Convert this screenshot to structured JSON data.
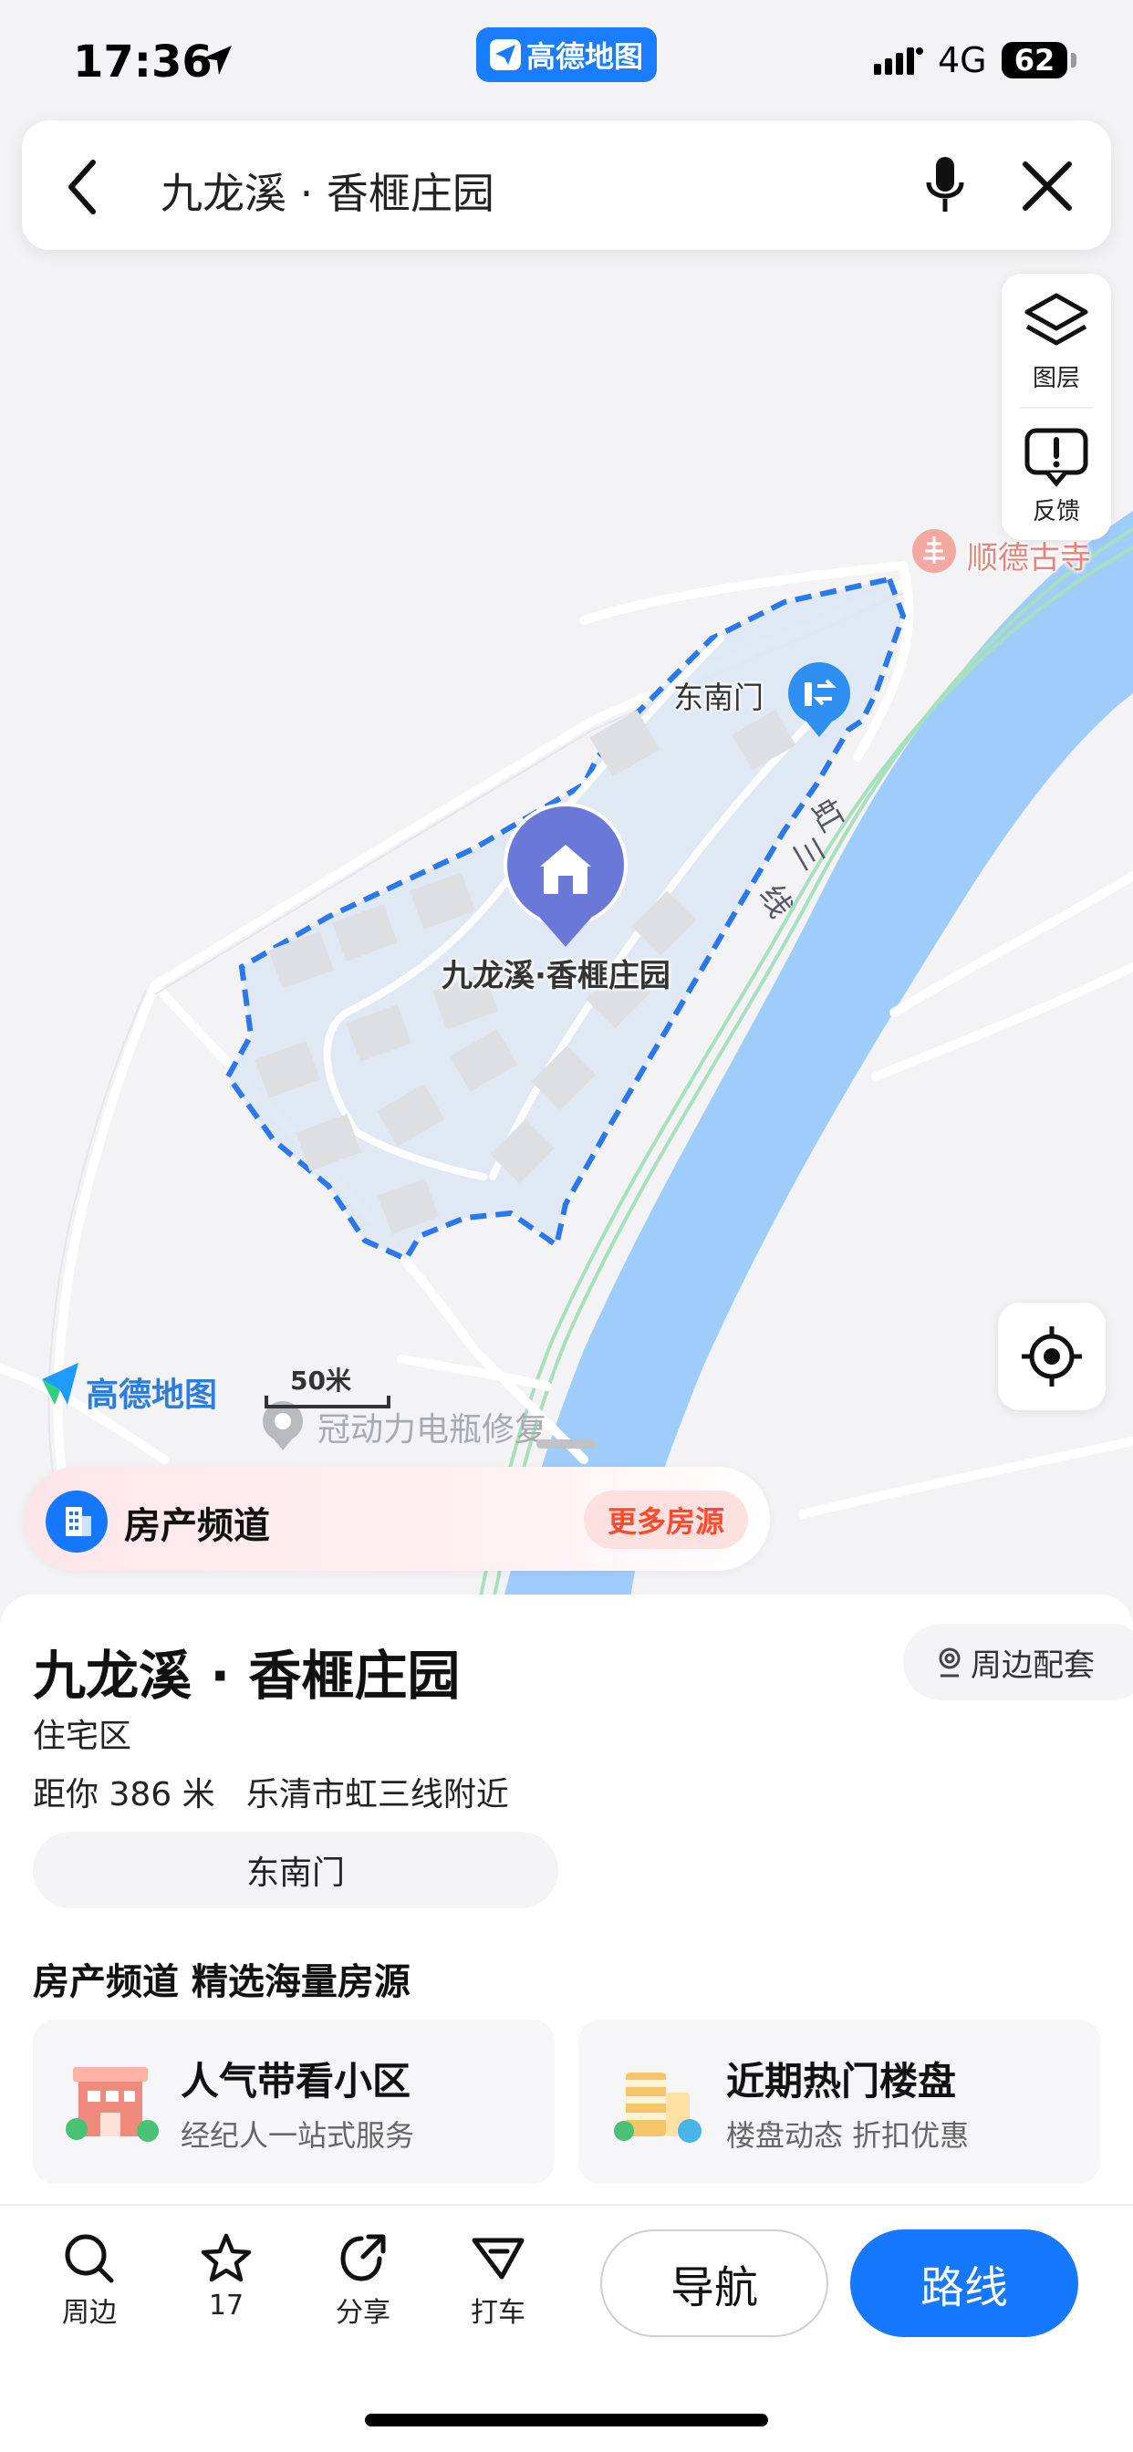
{
  "status_bar": {
    "time": "17:36",
    "app_badge": "高德地图",
    "network": "4G",
    "battery": "62"
  },
  "search": {
    "query": "九龙溪 · 香榧庄园"
  },
  "map_controls": {
    "layers_label": "图层",
    "feedback_label": "反馈"
  },
  "map": {
    "temple_label": "顺德古寺",
    "gate_label": "东南门",
    "road_label_1": "虹",
    "road_label_2": "三",
    "road_label_3": "线",
    "poi_marker_label": "九龙溪·香榧庄园",
    "watermark": "高德地图",
    "scale_label": "50米",
    "shop_label": "冠动力电瓶修复",
    "colors": {
      "river": "#9fcdfb",
      "area_fill": "#dce6f2",
      "boundary": "#2b77ec",
      "marker": "#6a78d8"
    }
  },
  "banner": {
    "title": "房产频道",
    "more_label": "更多房源"
  },
  "poi": {
    "title": "九龙溪 · 香榧庄园",
    "nearby_label": "周边配套",
    "type": "住宅区",
    "distance": "距你 386 米   乐清市虹三线附近",
    "gate_chip": "东南门",
    "section_title": "房产频道 精选海量房源",
    "cards": [
      {
        "title": "人气带看小区",
        "subtitle": "经纪人一站式服务"
      },
      {
        "title": "近期热门楼盘",
        "subtitle": "楼盘动态 折扣优惠"
      }
    ]
  },
  "tabbar": {
    "nearby": "周边",
    "favorite": "17",
    "share": "分享",
    "taxi": "打车",
    "navigate": "导航",
    "route": "路线"
  },
  "accent_color": "#1677ff"
}
